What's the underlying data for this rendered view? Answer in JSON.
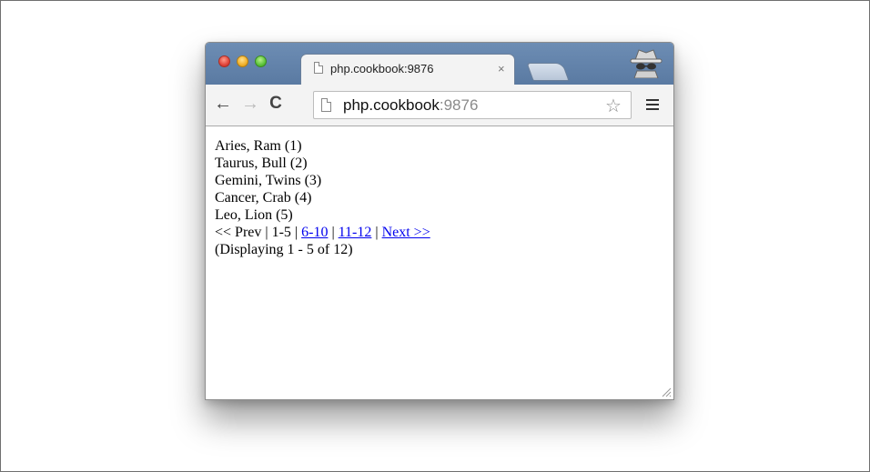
{
  "browser": {
    "tab": {
      "title": "php.cookbook:9876",
      "close_glyph": "×"
    },
    "toolbar": {
      "back_glyph": "←",
      "forward_glyph": "→",
      "reload_glyph": "C",
      "url_host": "php.cookbook",
      "url_port": ":9876",
      "star_glyph": "☆"
    },
    "icons": [
      "close-traffic-light",
      "minimize-traffic-light",
      "maximize-traffic-light",
      "document-icon",
      "new-tab-icon",
      "incognito-icon",
      "back-icon",
      "forward-icon",
      "reload-icon",
      "star-icon",
      "menu-icon",
      "resize-grip-icon"
    ]
  },
  "page": {
    "items": [
      "Aries, Ram (1)",
      "Taurus, Bull (2)",
      "Gemini, Twins (3)",
      "Cancer, Crab (4)",
      "Leo, Lion (5)"
    ],
    "pagination": {
      "prev": "<< Prev",
      "sep": " | ",
      "current": "1-5",
      "page2": "6-10",
      "page3": "11-12",
      "next": "Next >>"
    },
    "status": "(Displaying 1 - 5 of 12)"
  }
}
